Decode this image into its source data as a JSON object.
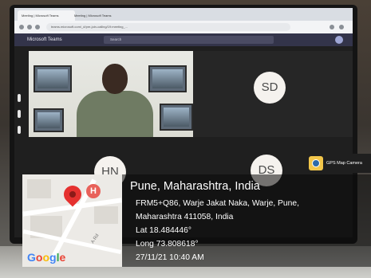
{
  "browser": {
    "tabs": [
      "Meeting | Microsoft Teams",
      "Meeting | Microsoft Teams"
    ],
    "url": "teams.microsoft.com/_#/pre-join-calling/19:meeting_..."
  },
  "teams": {
    "title": "Microsoft Teams",
    "search_placeholder": "Search"
  },
  "participants": [
    {
      "initials": "SD"
    },
    {
      "initials": "HN"
    },
    {
      "initials": "DS"
    }
  ],
  "gps": {
    "app_name": "GPS Map Camera",
    "city": "Pune, Maharashtra, India",
    "address_line1": "FRM5+Q86, Warje Jakat Naka, Warje, Pune,",
    "address_line2": "Maharashtra 411058, India",
    "lat": "Lat 18.484446°",
    "long": "Long 73.808618°",
    "datetime": "27/11/21 10:40 AM",
    "map_brand": "Google",
    "map_road_label": "A Rd"
  },
  "colors": {
    "google_blue": "#4285F4",
    "google_red": "#EA4335",
    "google_yellow": "#FBBC05",
    "google_green": "#34A853",
    "teams_bar": "#33344a"
  }
}
